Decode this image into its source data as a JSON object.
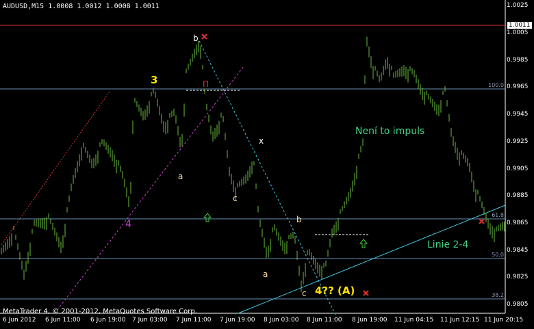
{
  "header": {
    "symbol": "AUDUSD,M15",
    "ohlc": "1.0008 1.0012 1.0008 1.0011"
  },
  "footer": {
    "copyright": "MetaTrader 4, © 2001-2012, MetaQuotes Software Corp."
  },
  "price_axis": {
    "labels": [
      "1.0025",
      "1.0005",
      "0.9985",
      "0.9965",
      "0.9945",
      "0.9925",
      "0.9905",
      "0.9885",
      "0.9865",
      "0.9845",
      "0.9825",
      "0.9805"
    ],
    "current_price": "1.0011"
  },
  "time_axis": {
    "labels": [
      "6 Jun 2012",
      "6 Jun 11:00",
      "6 Jun 19:00",
      "7 Jun 03:00",
      "7 Jun 11:00",
      "7 Jun 19:00",
      "8 Jun 03:00",
      "8 Jun 11:00",
      "8 Jun 19:00",
      "11 Jun 04:15",
      "11 Jun 12:15",
      "11 Jun 20:15"
    ]
  },
  "fib_levels": [
    "100.0",
    "61.8",
    "50.0",
    "38.2"
  ],
  "annotations": {
    "wave_3": "3",
    "wave_4": "4",
    "b_top": "b",
    "a_left": "a",
    "c_mid": "c",
    "x_mid": "x",
    "b_low": "b",
    "a_low": "a",
    "c_low": "c",
    "wave_4a": "4?? (A)",
    "impulse_note": "Není to impuls",
    "line_24": "Linie 2-4",
    "pi_symbol": "Π"
  },
  "colors": {
    "background": "#000000",
    "candles": "#6cbf3c",
    "horizontal_lines": "#6a8fb5",
    "red_line": "#e03030",
    "cyan_line": "#40c8e0",
    "magenta": "#d040d0",
    "yellow": "#ffe000",
    "green_text": "#40d080"
  }
}
